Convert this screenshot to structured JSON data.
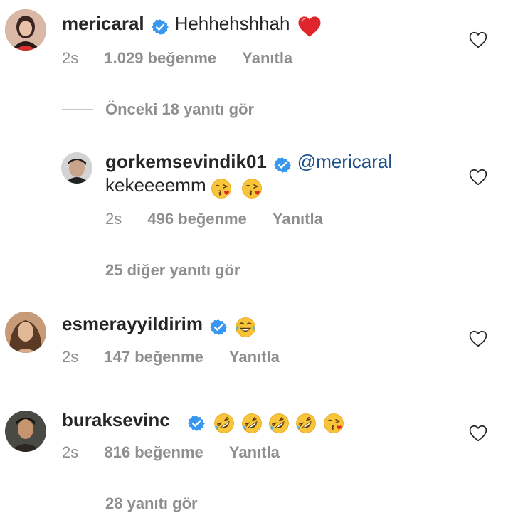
{
  "comments": [
    {
      "username": "mericaral",
      "text": "Hehhehshhah",
      "emoji": [
        "heart-red-emoji"
      ],
      "time": "2s",
      "likes": "1.029 beğenme",
      "reply": "Yanıtla"
    },
    {
      "username": "gorkemsevindik01",
      "mention": "@mericaral",
      "text": "kekeeeemm",
      "emoji": [
        "kissing-face-emoji",
        "kissing-face-emoji"
      ],
      "time": "2s",
      "likes": "496 beğenme",
      "reply": "Yanıtla"
    },
    {
      "username": "esmerayyildirim",
      "emoji": [
        "tears-of-joy-emoji"
      ],
      "time": "2s",
      "likes": "147 beğenme",
      "reply": "Yanıtla"
    },
    {
      "username": "buraksevinc_",
      "emoji": [
        "rolling-laughing-emoji",
        "rolling-laughing-emoji",
        "rolling-laughing-emoji",
        "rolling-laughing-emoji",
        "kissing-face-emoji"
      ],
      "time": "2s",
      "likes": "816 beğenme",
      "reply": "Yanıtla"
    }
  ],
  "threads": {
    "previous_replies": "Önceki 18 yanıtı gör",
    "other_replies": "25 diğer yanıtı gör",
    "view_replies": "28 yanıtı gör"
  },
  "colors": {
    "verified": "#3897f0",
    "secondary_text": "#8e8e8e",
    "mention": "#1a4f8a",
    "heart_emoji": "#e0242b"
  }
}
